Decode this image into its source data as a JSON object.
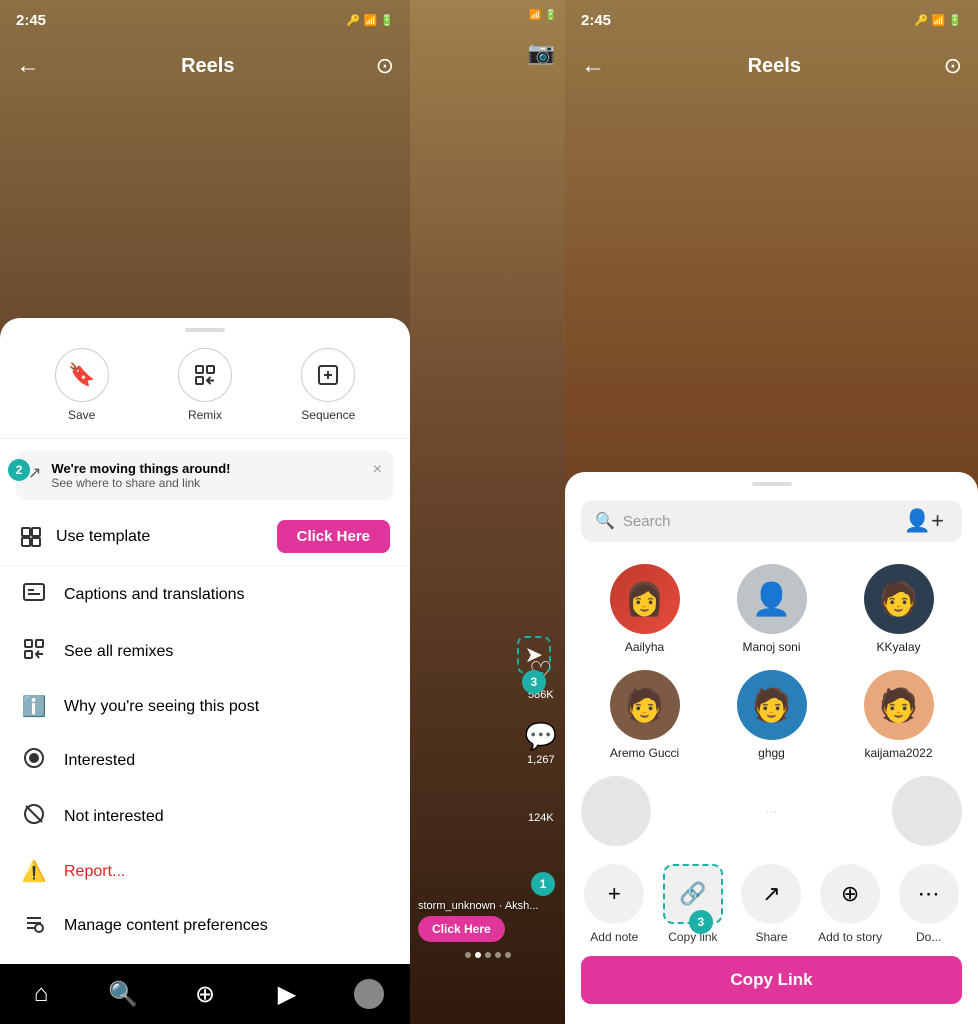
{
  "left": {
    "status_time": "2:45",
    "top_bar_title": "Reels",
    "back_icon": "←",
    "camera_icon": "⊙",
    "actions": [
      {
        "icon": "🔖",
        "label": "Save"
      },
      {
        "icon": "⊞",
        "label": "Remix"
      },
      {
        "icon": "⊕",
        "label": "Sequence"
      }
    ],
    "notification": {
      "icon": "↗",
      "title": "We're moving things around!",
      "subtitle": "See where to share and link",
      "badge": "2",
      "close_icon": "×"
    },
    "use_template_label": "Use template",
    "click_here_label": "Click Here",
    "menu_items": [
      {
        "icon": "cc",
        "label": "Captions and translations"
      },
      {
        "icon": "⊕",
        "label": "See all remixes"
      },
      {
        "icon": "ℹ",
        "label": "Why you're seeing this post"
      },
      {
        "icon": "◉",
        "label": "Interested"
      },
      {
        "icon": "◌",
        "label": "Not interested"
      },
      {
        "icon": "⚠",
        "label": "Report...",
        "red": true
      },
      {
        "icon": "⚙",
        "label": "Manage content preferences"
      }
    ],
    "nav_items": [
      "⌂",
      "🔍",
      "⊕",
      "▶",
      "👤"
    ]
  },
  "middle": {
    "like_count": "586K",
    "comment_count": "1,267",
    "share_count": "124K",
    "username": "storm_unknown · Aksh...",
    "click_here_label": "Click Here",
    "badge1": "1",
    "badge3": "3"
  },
  "right": {
    "status_time": "2:45",
    "top_bar_title": "Reels",
    "back_icon": "←",
    "camera_icon": "⊙",
    "search_placeholder": "Search",
    "add_contact_icon": "👤+",
    "contacts": [
      {
        "name": "Aailyha",
        "color": "av-red",
        "icon": "👩"
      },
      {
        "name": "Manoj soni",
        "color": "av-gray",
        "icon": "👤"
      },
      {
        "name": "KKyalay",
        "color": "av-dark",
        "icon": "🧑"
      },
      {
        "name": "Aremo Gucci",
        "color": "av-brown",
        "icon": "🧑"
      },
      {
        "name": "ghgg",
        "color": "av-blue",
        "icon": "🧑"
      },
      {
        "name": "kaijama2022",
        "color": "av-warm",
        "icon": "🧑"
      }
    ],
    "share_actions": [
      {
        "icon": "+",
        "label": "Add note"
      },
      {
        "icon": "🔗",
        "label": "Copy link"
      },
      {
        "icon": "↗",
        "label": "Share"
      },
      {
        "icon": "⊕",
        "label": "Add to story"
      },
      {
        "icon": "⋯",
        "label": "Do..."
      }
    ],
    "copy_link_btn_label": "Copy Link",
    "badge3": "3"
  }
}
